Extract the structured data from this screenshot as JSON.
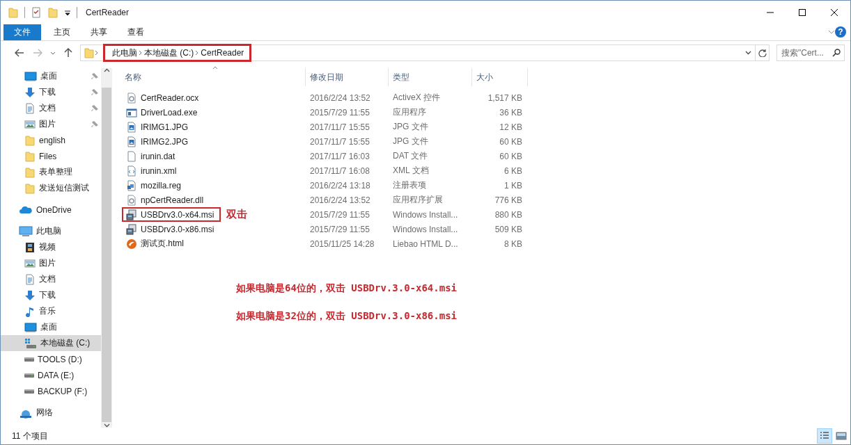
{
  "window": {
    "title": "CertReader"
  },
  "ribbon": {
    "tabs": [
      {
        "label": "文件",
        "kind": "file",
        "selected": false
      },
      {
        "label": "主页",
        "kind": "tab",
        "selected": false
      },
      {
        "label": "共享",
        "kind": "tab",
        "selected": false
      },
      {
        "label": "查看",
        "kind": "tab",
        "selected": false
      }
    ],
    "help": {
      "label": "?"
    }
  },
  "address": {
    "breadcrumb": [
      "此电脑",
      "本地磁盘 (C:)",
      "CertReader"
    ],
    "highlighted": true
  },
  "search": {
    "placeholder": "搜索\"Cert..."
  },
  "sidebar": {
    "quick_access": [
      {
        "label": "桌面",
        "kind": "desktop",
        "pinned": true
      },
      {
        "label": "下载",
        "kind": "download",
        "pinned": true
      },
      {
        "label": "文档",
        "kind": "document",
        "pinned": true
      },
      {
        "label": "图片",
        "kind": "picture",
        "pinned": true
      },
      {
        "label": "english",
        "kind": "folder",
        "pinned": false
      },
      {
        "label": "Files",
        "kind": "folder",
        "pinned": false
      },
      {
        "label": "表单整理",
        "kind": "folder",
        "pinned": false
      },
      {
        "label": "发送短信测试",
        "kind": "folder",
        "pinned": false
      }
    ],
    "locations": [
      {
        "label": "OneDrive",
        "kind": "cloud",
        "selected": false
      },
      {
        "label": "此电脑",
        "kind": "pc",
        "selected": false,
        "children": [
          {
            "label": "视频",
            "kind": "video",
            "selected": false
          },
          {
            "label": "图片",
            "kind": "picture",
            "selected": false
          },
          {
            "label": "文档",
            "kind": "document",
            "selected": false
          },
          {
            "label": "下载",
            "kind": "download",
            "selected": false
          },
          {
            "label": "音乐",
            "kind": "music",
            "selected": false
          },
          {
            "label": "桌面",
            "kind": "desktop",
            "selected": false
          },
          {
            "label": "本地磁盘 (C:)",
            "kind": "windrive",
            "selected": true
          },
          {
            "label": "TOOLS (D:)",
            "kind": "drive",
            "selected": false
          },
          {
            "label": "DATA (E:)",
            "kind": "drive",
            "selected": false
          },
          {
            "label": "BACKUP (F:)",
            "kind": "drive",
            "selected": false
          }
        ]
      },
      {
        "label": "网络",
        "kind": "network",
        "selected": false
      }
    ]
  },
  "file_list": {
    "columns": [
      {
        "label": "名称",
        "sorted": true
      },
      {
        "label": "修改日期",
        "sorted": false
      },
      {
        "label": "类型",
        "sorted": false
      },
      {
        "label": "大小",
        "sorted": false
      }
    ],
    "rows": [
      {
        "name": "CertReader.ocx",
        "kind": "gear",
        "date": "2016/2/24 13:52",
        "type": "ActiveX 控件",
        "size": "1,517 KB",
        "highlighted": false
      },
      {
        "name": "DriverLoad.exe",
        "kind": "app",
        "date": "2015/7/29 11:55",
        "type": "应用程序",
        "size": "36 KB",
        "highlighted": false
      },
      {
        "name": "IRIMG1.JPG",
        "kind": "image",
        "date": "2017/11/7 15:55",
        "type": "JPG 文件",
        "size": "12 KB",
        "highlighted": false
      },
      {
        "name": "IRIMG2.JPG",
        "kind": "image",
        "date": "2017/11/7 15:55",
        "type": "JPG 文件",
        "size": "60 KB",
        "highlighted": false
      },
      {
        "name": "irunin.dat",
        "kind": "blank",
        "date": "2017/11/7 16:03",
        "type": "DAT 文件",
        "size": "60 KB",
        "highlighted": false
      },
      {
        "name": "irunin.xml",
        "kind": "xml",
        "date": "2017/11/7 16:08",
        "type": "XML 文档",
        "size": "6 KB",
        "highlighted": false
      },
      {
        "name": "mozilla.reg",
        "kind": "reg",
        "date": "2016/2/24 13:18",
        "type": "注册表项",
        "size": "1 KB",
        "highlighted": false
      },
      {
        "name": "npCertReader.dll",
        "kind": "gear",
        "date": "2016/2/24 13:52",
        "type": "应用程序扩展",
        "size": "776 KB",
        "highlighted": false
      },
      {
        "name": "USBDrv3.0-x64.msi",
        "kind": "installer",
        "date": "2015/7/29 11:55",
        "type": "Windows Install...",
        "size": "880 KB",
        "highlighted": true,
        "note": "双击"
      },
      {
        "name": "USBDrv3.0-x86.msi",
        "kind": "installer",
        "date": "2015/7/29 11:55",
        "type": "Windows Install...",
        "size": "509 KB",
        "highlighted": false
      },
      {
        "name": "测试页.html",
        "kind": "browser",
        "date": "2015/11/25 14:28",
        "type": "Liebao HTML D...",
        "size": "8 KB",
        "highlighted": false
      }
    ],
    "annotations": [
      "如果电脑是64位的，双击 USBDrv.3.0-x64.msi",
      "如果电脑是32位的，双击 USBDrv.3.0-x86.msi"
    ]
  },
  "status_bar": {
    "item_count": "11 个项目",
    "views": [
      {
        "kind": "details",
        "selected": true
      },
      {
        "kind": "thumbnails",
        "selected": false
      }
    ]
  }
}
